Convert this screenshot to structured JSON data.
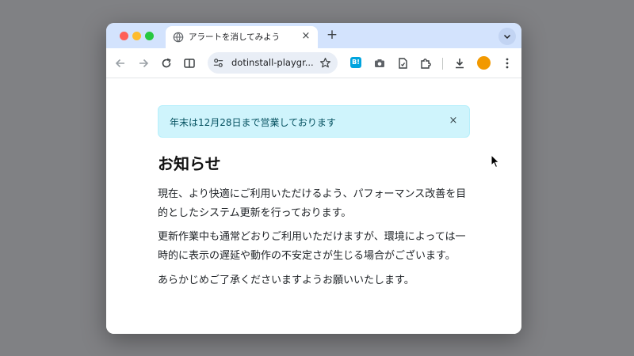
{
  "browser": {
    "tab": {
      "title": "アラートを消してみよう",
      "close_label": "×"
    },
    "new_tab_label": "+",
    "omnibox": {
      "url": "dotinstall-playgr..."
    },
    "extension_hatena_label": "B!",
    "profile_color": "#f29900"
  },
  "alert": {
    "message": "年末は12月28日まで営業しております",
    "close_label": "×",
    "background": "#cff4fc",
    "text_color": "#055160"
  },
  "article": {
    "heading": "お知らせ",
    "paragraphs": [
      "現在、より快適にご利用いただけるよう、パフォーマンス改善を目的としたシステム更新を行っております。",
      "更新作業中も通常どおりご利用いただけますが、環境によっては一時的に表示の遅延や動作の不安定さが生じる場合がございます。",
      "あらかじめご了承くださいますようお願いいたします。"
    ]
  }
}
